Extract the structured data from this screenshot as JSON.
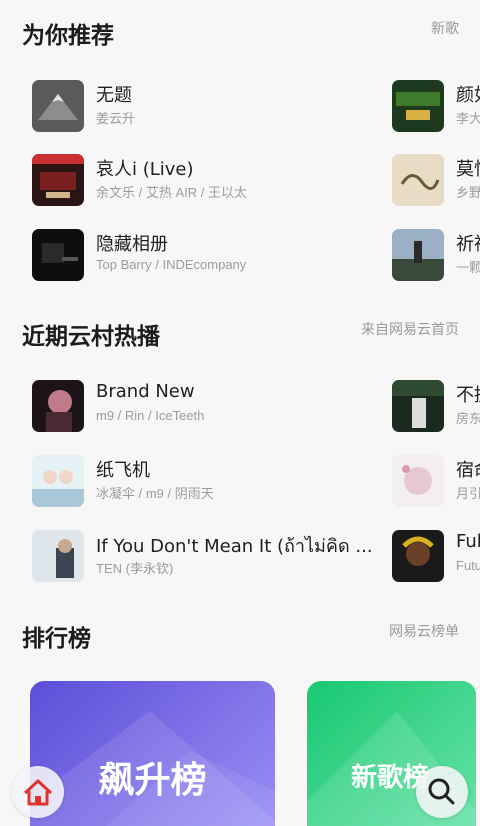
{
  "recommend": {
    "title": "为你推荐",
    "link": "新歌",
    "left": [
      {
        "title": "无题",
        "artist": "姜云升"
      },
      {
        "title": "哀人i (Live)",
        "artist": "余文乐 / 艾热 AIR / 王以太"
      },
      {
        "title": "隐藏相册",
        "artist": "Top Barry / INDEcompany"
      }
    ],
    "right": [
      {
        "title": "颜如",
        "artist": "李大"
      },
      {
        "title": "莫怕",
        "artist": "乡野"
      },
      {
        "title": "祈祷",
        "artist": "一颗"
      }
    ]
  },
  "hot": {
    "title": "近期云村热播",
    "link": "来自网易云首页",
    "left": [
      {
        "title": "Brand New",
        "artist": "m9 / Rin / IceTeeth"
      },
      {
        "title": "纸飞机",
        "artist": "冰凝伞 / m9 / 阴雨天"
      },
      {
        "title": "If You Don't Mean It (ถ้าไม่คิด ...",
        "artist": "TEN (李永钦)"
      }
    ],
    "right": [
      {
        "title": "不提",
        "artist": "房东"
      },
      {
        "title": "宿命",
        "artist": "月引"
      },
      {
        "title": "Ful",
        "artist": "Futu"
      }
    ]
  },
  "charts": {
    "title": "排行榜",
    "link": "网易云榜单",
    "cards": [
      {
        "label": "飙升榜",
        "color_from": "#6a5ce0",
        "color_to": "#9b8cf7"
      },
      {
        "label": "新歌榜",
        "color_from": "#1fd07a",
        "color_to": "#63e6a4"
      }
    ]
  },
  "nav": {
    "home_icon": "home-icon",
    "search_icon": "search-icon"
  }
}
